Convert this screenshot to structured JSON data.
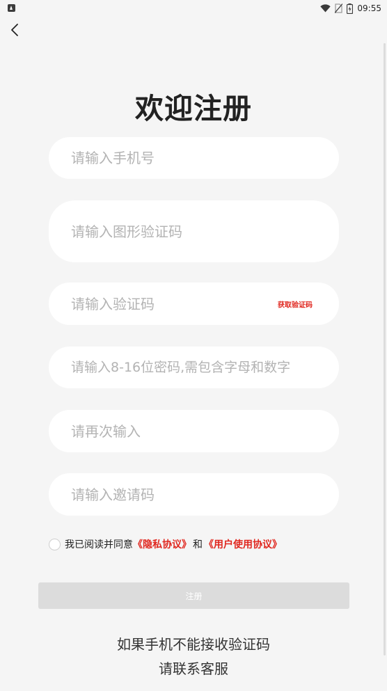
{
  "status_bar": {
    "time": "09:55",
    "icons": [
      "notification-app-icon",
      "wifi-icon",
      "no-sim-icon",
      "battery-charging-icon"
    ]
  },
  "nav": {
    "back_icon": "chevron-left-icon"
  },
  "title": "欢迎注册",
  "form": {
    "phone": {
      "placeholder": "请输入手机号",
      "value": ""
    },
    "captcha": {
      "placeholder": "请输入图形验证码",
      "value": ""
    },
    "sms_code": {
      "placeholder": "请输入验证码",
      "value": "",
      "get_code_label": "获取验证码"
    },
    "password": {
      "placeholder": "请输入8-16位密码,需包含字母和数字",
      "value": ""
    },
    "confirm_password": {
      "placeholder": "请再次输入",
      "value": ""
    },
    "invite_code": {
      "placeholder": "请输入邀请码",
      "value": ""
    }
  },
  "agreement": {
    "checked": false,
    "text": "我已阅读并同意",
    "privacy_link": "《隐私协议》",
    "and": "和",
    "user_link": "《用户使用协议》"
  },
  "submit_label": "注册",
  "help": {
    "line1": "如果手机不能接收验证码",
    "line2": "请联系客服"
  },
  "colors": {
    "background": "#f5f5f5",
    "field": "#ffffff",
    "accent_red": "#e0271f",
    "submit_disabled": "#dcdcdc"
  }
}
